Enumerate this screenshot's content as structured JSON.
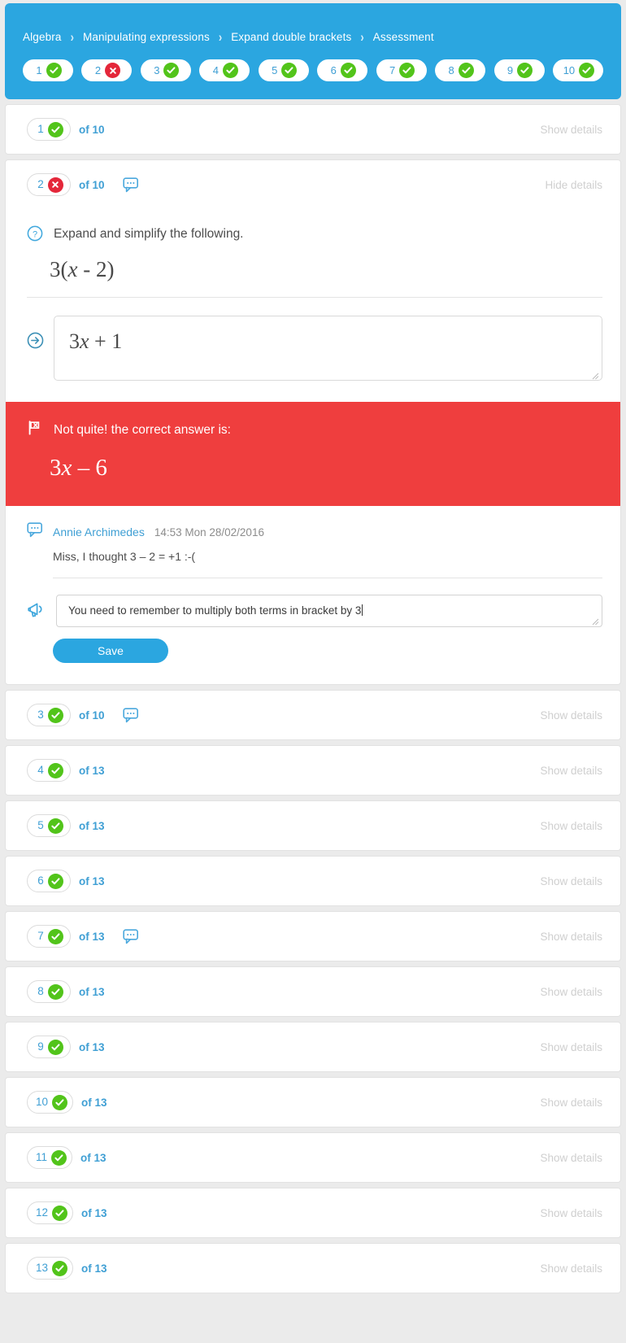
{
  "header": {
    "breadcrumb": [
      "Algebra",
      "Manipulating expressions",
      "Expand double brackets",
      "Assessment"
    ],
    "separator": "›",
    "accent_color": "#2ba6e0",
    "pills": [
      {
        "num": "1",
        "status": "correct"
      },
      {
        "num": "2",
        "status": "incorrect"
      },
      {
        "num": "3",
        "status": "correct"
      },
      {
        "num": "4",
        "status": "correct"
      },
      {
        "num": "5",
        "status": "correct"
      },
      {
        "num": "6",
        "status": "correct"
      },
      {
        "num": "7",
        "status": "correct"
      },
      {
        "num": "8",
        "status": "correct"
      },
      {
        "num": "9",
        "status": "correct"
      },
      {
        "num": "10",
        "status": "correct"
      }
    ]
  },
  "labels": {
    "show_details": "Show details",
    "hide_details": "Hide details",
    "save": "Save"
  },
  "colors": {
    "accent": "#2ba6e0",
    "correct": "#52c41a",
    "incorrect": "#e4273a",
    "error_banner": "#ef3e3e",
    "muted": "#cfcfcf"
  },
  "rows": [
    {
      "num": "1",
      "of": "of 10",
      "status": "correct",
      "has_comment": false,
      "toggle": "Show details",
      "expanded": false
    },
    {
      "num": "2",
      "of": "of 10",
      "status": "incorrect",
      "has_comment": true,
      "toggle": "Hide details",
      "expanded": true
    },
    {
      "num": "3",
      "of": "of 10",
      "status": "correct",
      "has_comment": true,
      "toggle": "Show details",
      "expanded": false
    },
    {
      "num": "4",
      "of": "of 13",
      "status": "correct",
      "has_comment": false,
      "toggle": "Show details",
      "expanded": false
    },
    {
      "num": "5",
      "of": "of 13",
      "status": "correct",
      "has_comment": false,
      "toggle": "Show details",
      "expanded": false
    },
    {
      "num": "6",
      "of": "of 13",
      "status": "correct",
      "has_comment": false,
      "toggle": "Show details",
      "expanded": false
    },
    {
      "num": "7",
      "of": "of 13",
      "status": "correct",
      "has_comment": true,
      "toggle": "Show details",
      "expanded": false
    },
    {
      "num": "8",
      "of": "of 13",
      "status": "correct",
      "has_comment": false,
      "toggle": "Show details",
      "expanded": false
    },
    {
      "num": "9",
      "of": "of 13",
      "status": "correct",
      "has_comment": false,
      "toggle": "Show details",
      "expanded": false
    },
    {
      "num": "10",
      "of": "of 13",
      "status": "correct",
      "has_comment": false,
      "toggle": "Show details",
      "expanded": false
    },
    {
      "num": "11",
      "of": "of 13",
      "status": "correct",
      "has_comment": false,
      "toggle": "Show details",
      "expanded": false
    },
    {
      "num": "12",
      "of": "of 13",
      "status": "correct",
      "has_comment": false,
      "toggle": "Show details",
      "expanded": false
    },
    {
      "num": "13",
      "of": "of 13",
      "status": "correct",
      "has_comment": false,
      "toggle": "Show details",
      "expanded": false
    }
  ],
  "detail": {
    "question_prompt": "Expand and simplify the following.",
    "question_math_pre": "3(",
    "question_math_var": "x",
    "question_math_post": " - 2)",
    "student_answer_pre": "3",
    "student_answer_var": "x",
    "student_answer_post": " + 1",
    "feedback_title": "Not quite! the correct answer is:",
    "correct_answer_pre": "3",
    "correct_answer_var": "x",
    "correct_answer_post": " – 6",
    "comment": {
      "author": "Annie Archimedes",
      "timestamp": "14:53 Mon 28/02/2016",
      "text": "Miss, I thought 3 – 2 = +1 :-("
    },
    "reply": {
      "value": "You  need to remember to multiply both terms in bracket by 3",
      "placeholder": ""
    }
  }
}
